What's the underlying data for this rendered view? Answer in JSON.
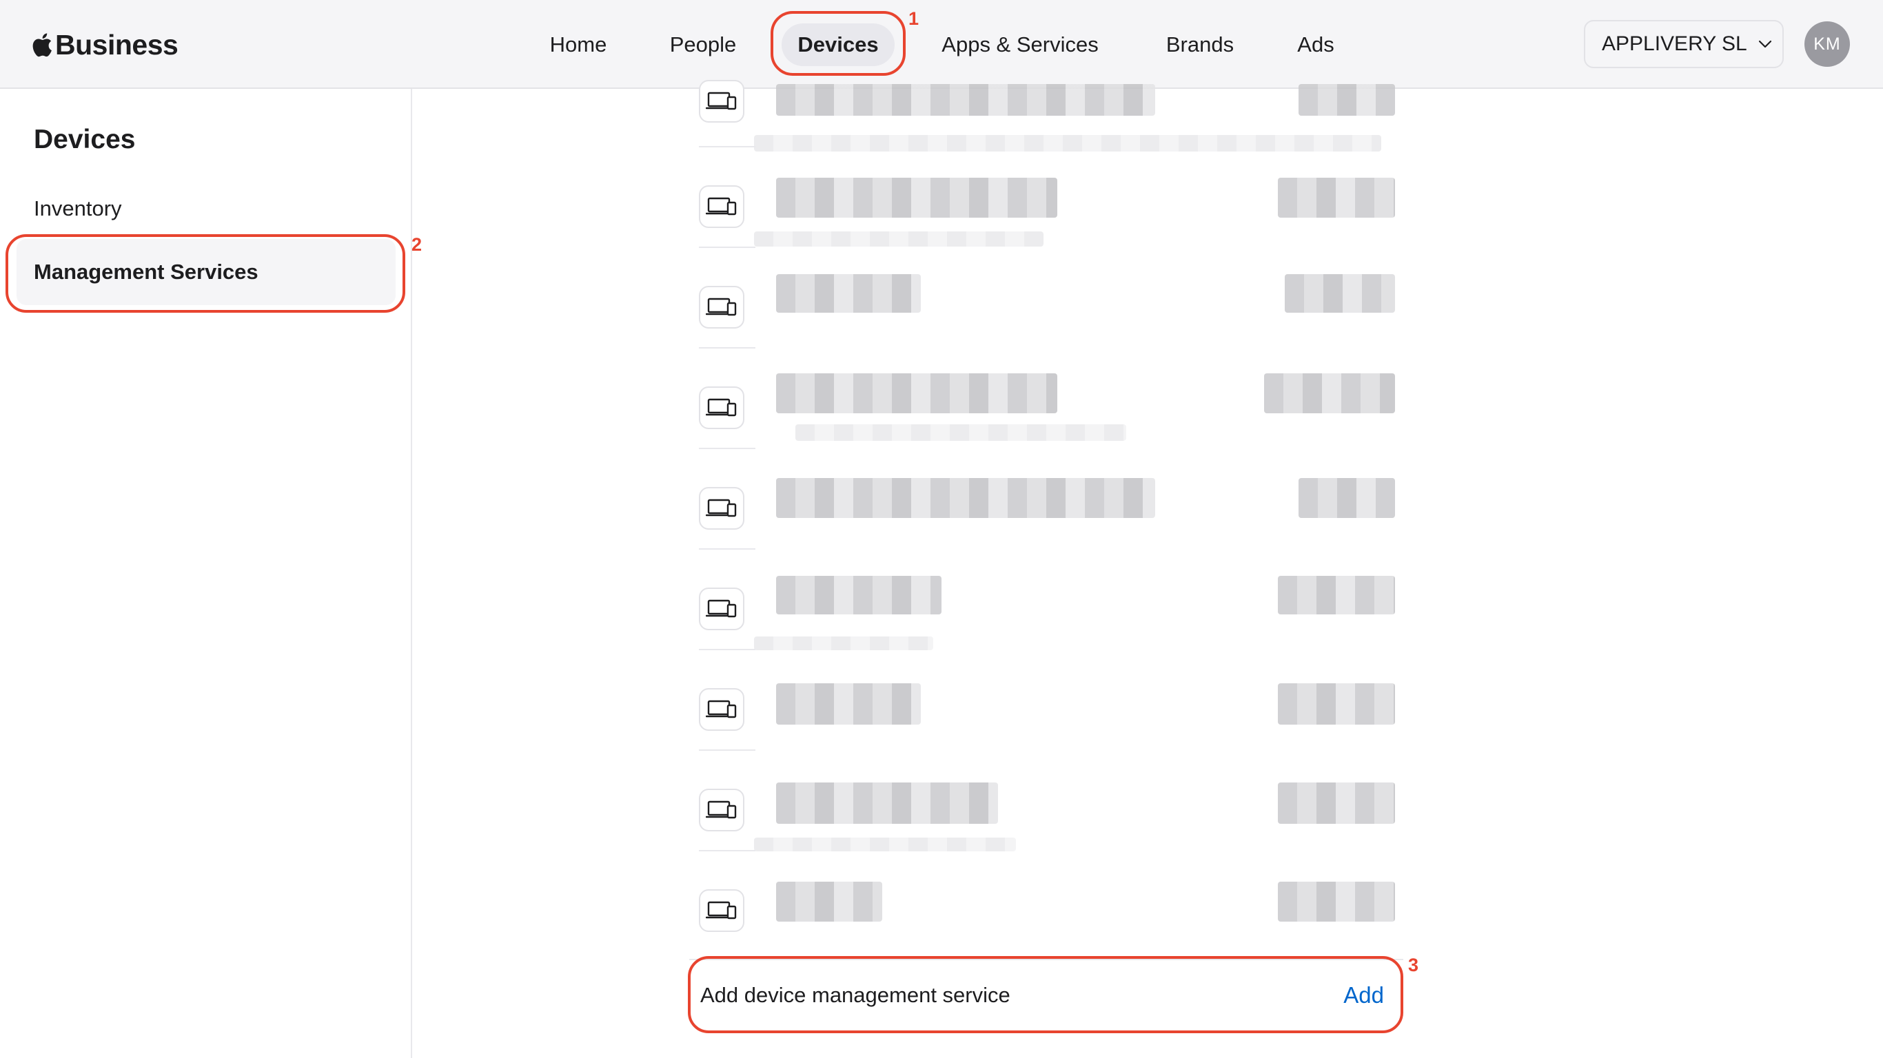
{
  "brand": {
    "name": "Business"
  },
  "nav": {
    "items": [
      {
        "label": "Home",
        "active": false
      },
      {
        "label": "People",
        "active": false
      },
      {
        "label": "Devices",
        "active": true
      },
      {
        "label": "Apps & Services",
        "active": false
      },
      {
        "label": "Brands",
        "active": false
      },
      {
        "label": "Ads",
        "active": false
      }
    ],
    "org_label": "APPLIVERY SL",
    "avatar_initials": "KM"
  },
  "sidebar": {
    "title": "Devices",
    "items": [
      {
        "label": "Inventory",
        "selected": false
      },
      {
        "label": "Management Services",
        "selected": true
      }
    ]
  },
  "main": {
    "add_row": {
      "label": "Add device management service",
      "action": "Add"
    }
  },
  "annotations": [
    "1",
    "2",
    "3"
  ],
  "colors": {
    "accent_link": "#0066cc",
    "callout": "#e8442f",
    "nav_bg": "#f5f5f7",
    "avatar_bg": "#9a9aa0"
  }
}
